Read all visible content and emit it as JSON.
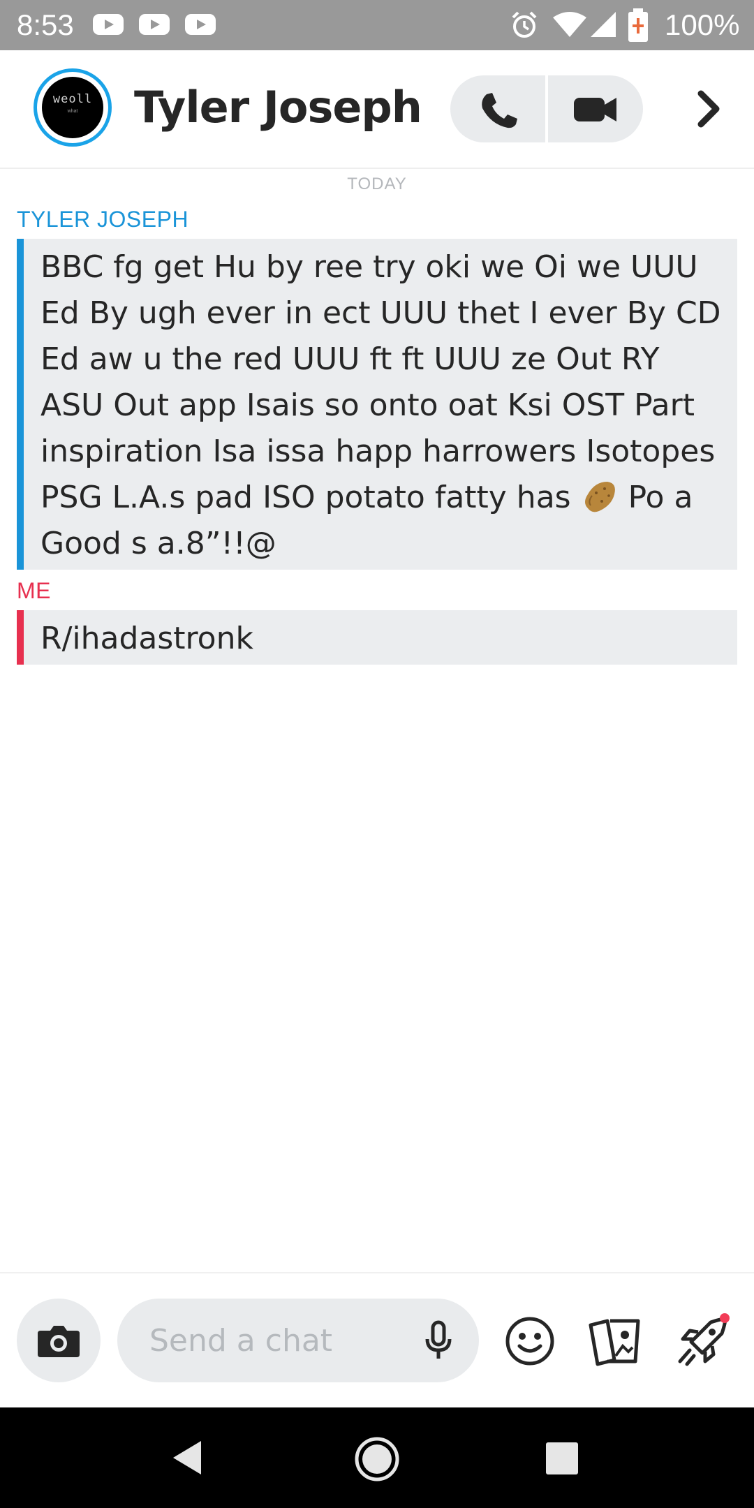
{
  "status_bar": {
    "time": "8:53",
    "battery": "100%",
    "icons": [
      "youtube-icon",
      "youtube-icon",
      "youtube-icon",
      "alarm-icon",
      "wifi-icon",
      "signal-icon",
      "battery-charging-icon"
    ]
  },
  "header": {
    "contact_name": "Tyler Joseph",
    "avatar_text": "weoll",
    "avatar_subtext": "what",
    "call_icon": "phone-icon",
    "video_icon": "video-camera-icon",
    "more_icon": "chevron-right-icon"
  },
  "chat": {
    "date_divider": "TODAY",
    "messages": [
      {
        "sender": "TYLER JOSEPH",
        "text_before_emoji": "BBC fg  get Hu by ree try oki we Oi we UUU Ed By ugh ever in ect UUU thet I ever By CD Ed aw u the red UUU ft ft UUU ze Out RY ASU Out app Isais so  onto oat Ksi OST Part inspiration Isa issa happ harrowers Isotopes PSG L.A.s pad ISO potato  fatty has",
        "emoji": "potato-emoji",
        "text_after_emoji": " Po a Good s a.8”!!@"
      },
      {
        "sender": "ME",
        "text": "R/ihadastronk"
      }
    ]
  },
  "composer": {
    "placeholder": "Send a chat",
    "camera_icon": "camera-icon",
    "mic_icon": "microphone-icon",
    "emoji_icon": "smiley-icon",
    "cards_icon": "cards-icon",
    "rocket_icon": "rocket-icon"
  },
  "colors": {
    "them": "#1a94d8",
    "me": "#e7304f",
    "bubble": "#ebedef"
  }
}
